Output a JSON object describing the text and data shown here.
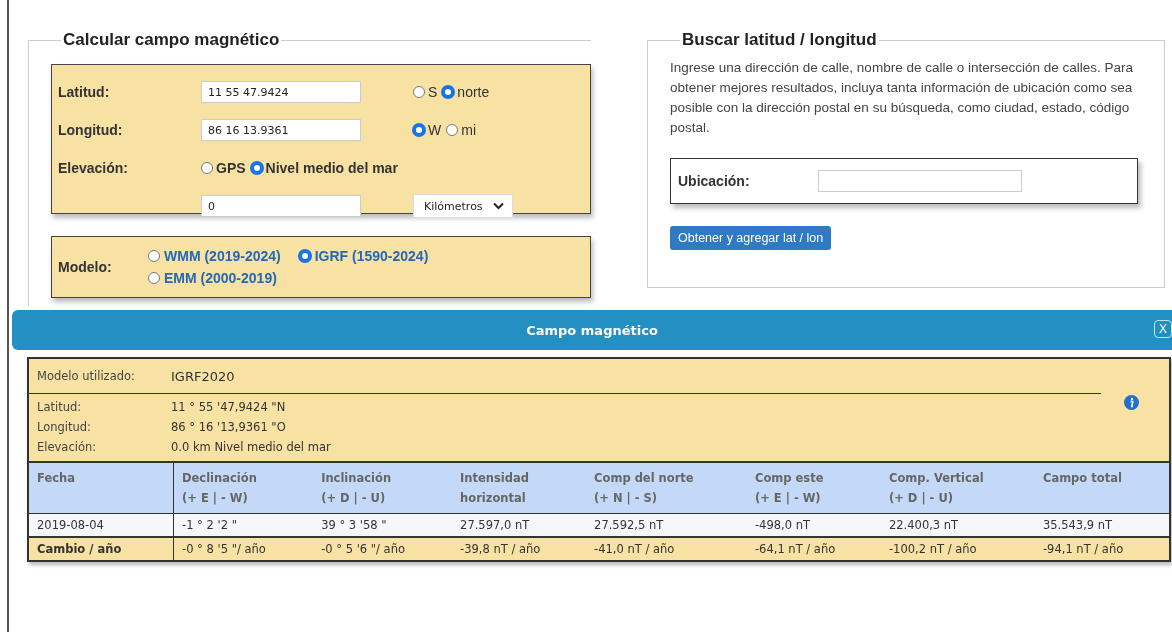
{
  "calc": {
    "title": "Calcular campo magnético",
    "coords": [
      {
        "label": "Latitud:",
        "value": "11 55 47.9424",
        "options": [
          {
            "label": "S",
            "selected": false
          },
          {
            "label": "norte",
            "selected": true
          }
        ]
      },
      {
        "label": "Longitud:",
        "value": "86 16 13.9361",
        "options": [
          {
            "label": "W",
            "selected": true
          },
          {
            "label": "mi",
            "selected": false
          }
        ]
      }
    ],
    "elevation": {
      "label": "Elevación:",
      "options": [
        {
          "label": "GPS",
          "selected": false
        },
        {
          "label": "Nivel medio del mar",
          "selected": true
        }
      ],
      "value": "0",
      "unit": "Kilómetros"
    },
    "model": {
      "label": "Modelo:",
      "options": [
        {
          "label": "WMM (2019-2024)",
          "selected": false
        },
        {
          "label": "IGRF (1590-2024)",
          "selected": true
        },
        {
          "label": "EMM (2000-2019)",
          "selected": false
        }
      ]
    }
  },
  "search": {
    "title": "Buscar latitud / longitud",
    "description": "Ingrese una dirección de calle, nombre de calle o intersección de calles. Para obtener mejores resultados, incluya tanta información de ubicación como sea posible con la dirección postal en su búsqueda, como ciudad, estado, código postal.",
    "location_label": "Ubicación:",
    "button": "Obtener y agregar lat / lon"
  },
  "result": {
    "title": "Campo magnético",
    "close": "X",
    "model": {
      "label": "Modelo utilizado:",
      "value": "IGRF2020"
    },
    "info": [
      {
        "label": "Latitud:",
        "value": "11 ° 55 '47,9424 \"N"
      },
      {
        "label": "Longitud:",
        "value": "86 ° 16 '13,9361 \"O"
      },
      {
        "label": "Elevación:",
        "value": "0.0 km Nivel medio del mar"
      }
    ],
    "columns": [
      {
        "name": "Fecha"
      },
      {
        "name": "Declinación",
        "sub": "(+ E | - W)"
      },
      {
        "name": "Inclinación",
        "sub": "(+ D | - U)"
      },
      {
        "name": "Intensidad",
        "sub": "horizontal"
      },
      {
        "name": "Comp del norte",
        "sub": "(+ N | - S)"
      },
      {
        "name": "Comp este",
        "sub": "(+ E | - W)"
      },
      {
        "name": "Comp. Vertical",
        "sub": "(+ D | - U)"
      },
      {
        "name": "Campo total"
      }
    ],
    "rows": [
      {
        "kind": "value",
        "cells": [
          "2019-08-04",
          "-1 ° 2 '2 \"",
          "39 ° 3 '58 \"",
          "27.597,0 nT",
          "27.592,5 nT",
          "-498,0 nT",
          "22.400,3 nT",
          "35.543,9 nT"
        ]
      },
      {
        "kind": "change",
        "cells": [
          "Cambio / año",
          "-0 ° 8 '5 \"/ año",
          "-0 ° 5 '6 \"/ año",
          "-39,8 nT / año",
          "-41,0 nT / año",
          "-64,1 nT / año",
          "-100,2 nT / año",
          "-94,1 nT / año"
        ]
      }
    ]
  }
}
